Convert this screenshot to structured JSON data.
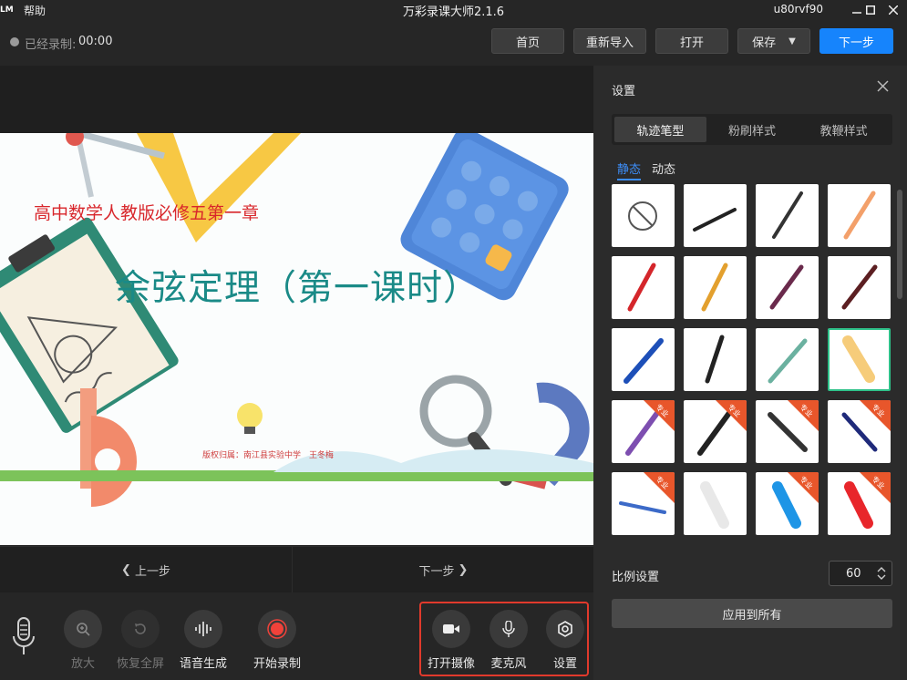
{
  "titlebar": {
    "logo": "LM",
    "help": "帮助",
    "title": "万彩录课大师2.1.6",
    "username": "u80rvf90"
  },
  "toolbar": {
    "recorded_label": "已经录制:",
    "recorded_time": "00:00",
    "home": "首页",
    "reimport": "重新导入",
    "open": "打开",
    "save": "保存",
    "next_step": "下一步"
  },
  "slide": {
    "subtitle": "高中数学人教版必修五第一章",
    "title": "余弦定理（第一课时）",
    "copyright": "版权归属：南江县实验中学　王冬梅"
  },
  "nav": {
    "prev": "上一步",
    "next": "下一步"
  },
  "bottombar": {
    "zoom_in": "放大",
    "restore_fullscreen": "恢复全屏",
    "voice_generate": "语音生成",
    "start_record": "开始录制",
    "open_camera": "打开摄像",
    "microphone": "麦克风",
    "settings": "设置"
  },
  "panel": {
    "title": "设置",
    "tabs": [
      "轨迹笔型",
      "粉刷样式",
      "教鞭样式"
    ],
    "subtabs": [
      "静态",
      "动态"
    ],
    "pro_badge": "专业",
    "ratio_label": "比例设置",
    "ratio_value": "60",
    "apply_all": "应用到所有"
  },
  "colors": {
    "accent": "#1684fc",
    "selected_border": "#2fc28a",
    "highlight_red": "#e13a2c"
  }
}
